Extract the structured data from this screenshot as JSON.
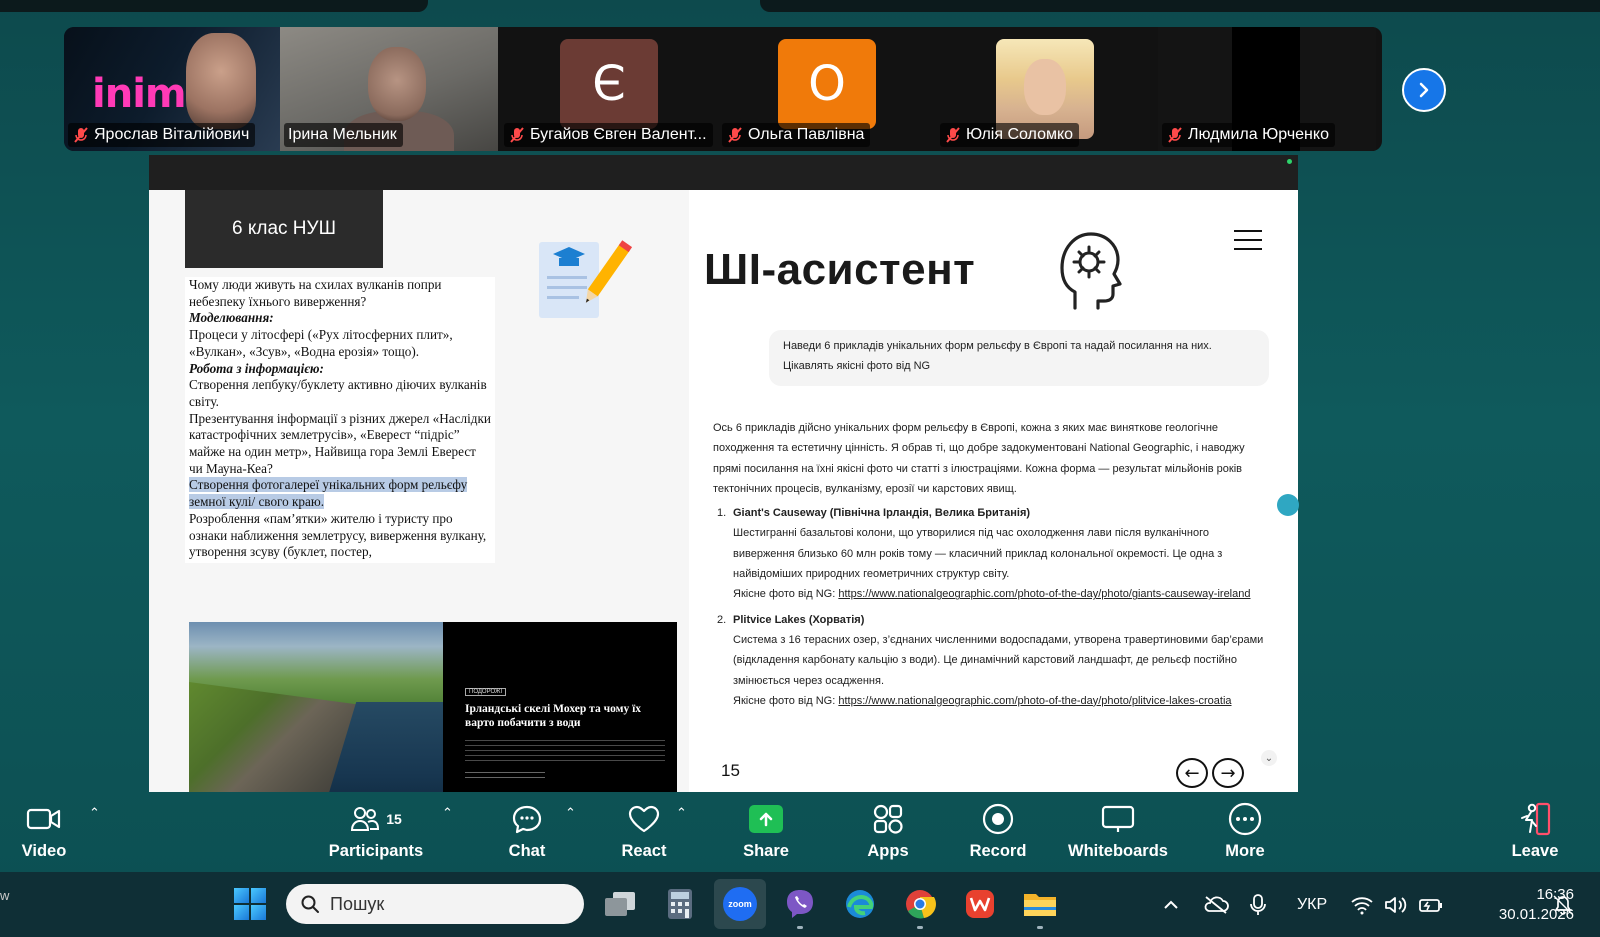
{
  "meeting": {
    "participants_strip": [
      {
        "name": "Ярослав Віталійович",
        "muted": true,
        "kind": "video"
      },
      {
        "name": "Ірина Мельник",
        "muted": false,
        "kind": "video",
        "active_speaker": true
      },
      {
        "name": "Бугайов Євген Валент...",
        "muted": true,
        "kind": "avatar",
        "initial": "Є",
        "color": "#6b3b34"
      },
      {
        "name": "Ольга Павлівна",
        "muted": true,
        "kind": "avatar",
        "initial": "О",
        "color": "#f07a0a"
      },
      {
        "name": "Юлія Соломко",
        "muted": true,
        "kind": "photo"
      },
      {
        "name": "Людмила Юрченко",
        "muted": true,
        "kind": "video"
      }
    ],
    "brand_text": "inime"
  },
  "slide": {
    "class_badge": "6 клас НУШ",
    "doc_lines": [
      {
        "text": "Чому люди живуть на схилах вулканів попри небезпеку їхнього виверження?",
        "style": "normal"
      },
      {
        "text": "Моделювання:",
        "style": "bold-italic"
      },
      {
        "text": "Процеси у літосфері («Рух літосферних плит», «Вулкан», «Зсув», «Водна ерозія» тощо).",
        "style": "normal"
      },
      {
        "text": "Робота з інформацією:",
        "style": "bold-italic"
      },
      {
        "text": "Створення лепбуку/буклету активно діючих вулканів світу.",
        "style": "normal"
      },
      {
        "text": "Презентування інформації з різних джерел «Наслідки катастрофічних землетрусів», «Еверест “підріс” майже на один метр», Найвища гора Землі Еверест чи Мауна-Кеа?",
        "style": "normal"
      },
      {
        "text": "Створення фотогалереї унікальних форм рельєфу земної кулі/ свого краю.",
        "style": "highlight"
      },
      {
        "text": "Розроблення «пам’ятки» жителю і туристу про ознаки наближення землетрусу, виверження вулкану, утворення зсуву (буклет, постер,",
        "style": "normal"
      }
    ],
    "article": {
      "tag": "ПОДОРОЖІ",
      "title": "Ірландські скелі Мохер та чому їх варто побачити з води"
    },
    "ai_title": "ШІ-асистент",
    "prompt": "Наведи 6 прикладів унікальних форм рельєфу в Європі та надай посилання на них. Цікавлять якісні фото від NG",
    "answer_intro": "Ось 6 прикладів дійсно унікальних форм рельєфу в Європі, кожна з яких має виняткове геологічне походження та естетичну цінність. Я обрав ті, що добре задокументовані National Geographic, і наводжу прямі посилання на їхні якісні фото чи статті з ілюстраціями. Кожна форма — результат мільйонів років тектонічних процесів, вулканізму, ерозії чи карстових явищ.",
    "answer_items": [
      {
        "num": "1.",
        "title": "Giant's Causeway (Північна Ірландія, Велика Британія)",
        "desc": "Шестигранні базальтові колони, що утворилися під час охолодження лави після вулканічного виверження близько 60 млн років тому — класичний приклад колональної окремості. Це одна з найвідоміших природних геометричних структур світу.",
        "photo_label": "Якісне фото від NG:",
        "link": "https://www.nationalgeographic.com/photo-of-the-day/photo/giants-causeway-ireland"
      },
      {
        "num": "2.",
        "title": "Plitvice Lakes (Хорватія)",
        "desc": "Система з 16 терасних озер, з’єднаних численними водоспадами, утворена травертиновими бар’єрами (відкладення карбонату кальцію з води). Це динамічний карстовий ландшафт, де рельєф постійно змінюється через осадження.",
        "photo_label": "Якісне фото від NG:",
        "link": "https://www.nationalgeographic.com/photo-of-the-day/photo/plitvice-lakes-croatia"
      }
    ],
    "page_number": "15",
    "prev_arrow": "←",
    "next_arrow": "→"
  },
  "toolbar": {
    "video": "Video",
    "participants": "Participants",
    "participants_count": "15",
    "chat": "Chat",
    "react": "React",
    "share": "Share",
    "apps": "Apps",
    "record": "Record",
    "whiteboards": "Whiteboards",
    "more": "More",
    "leave": "Leave"
  },
  "taskbar": {
    "left_text": "w",
    "search_placeholder": "Пошук",
    "language": "УКР",
    "time": "16:36",
    "date": "30.01.2026",
    "zoom_app_label": "zoom"
  },
  "colors": {
    "accent_blue": "#1676e8",
    "active_speaker": "#22d07a",
    "share_green": "#1fbf55"
  }
}
